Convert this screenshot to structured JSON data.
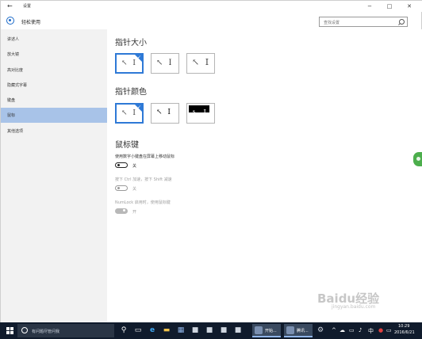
{
  "window": {
    "back_glyph": "←",
    "title": "设置",
    "minimize_glyph": "−",
    "maximize_glyph": "□",
    "close_glyph": "✕"
  },
  "header": {
    "page_title": "轻松使用",
    "search_placeholder": "查找设置"
  },
  "sidebar": {
    "items": [
      {
        "label": "讲述人",
        "active": false
      },
      {
        "label": "放大镜",
        "active": false
      },
      {
        "label": "高对比度",
        "active": false
      },
      {
        "label": "隐藏式字幕",
        "active": false
      },
      {
        "label": "键盘",
        "active": false
      },
      {
        "label": "鼠标",
        "active": true
      },
      {
        "label": "其他选项",
        "active": false
      }
    ]
  },
  "main": {
    "pointer_size": {
      "title": "指针大小",
      "options": [
        {
          "sample": "↖ I",
          "selected": true
        },
        {
          "sample": "↖ I",
          "selected": false
        },
        {
          "sample": "↖ I",
          "selected": false
        }
      ]
    },
    "pointer_color": {
      "title": "指针颜色",
      "options": [
        {
          "sample": "↖ I",
          "selected": true,
          "style": "white"
        },
        {
          "sample": "↖ I",
          "selected": false,
          "style": "black"
        },
        {
          "sample": "↖ I",
          "selected": false,
          "style": "inverted"
        }
      ]
    },
    "mouse_keys": {
      "title": "鼠标键",
      "setting1_label": "使用数字小键盘在屏幕上移动鼠标",
      "setting1_state": "关",
      "setting2_label": "按下 Ctrl 加速，按下 Shift 减速",
      "setting2_state": "关",
      "setting3_label": "NumLock 启用时，使用鼠标键",
      "setting3_state": "开"
    }
  },
  "watermark": {
    "text": "Baidu经验",
    "sub": "jingyan.baidu.com"
  },
  "taskbar": {
    "search_text": "有问题尽管问我",
    "app1": "开始...",
    "app2": "腾讯...",
    "time": "10:29",
    "date": "2016/6/21"
  },
  "colors": {
    "accent": "#2e79d6",
    "sidebar_active": "#a8c3e8",
    "taskbar": "#101b2c"
  }
}
